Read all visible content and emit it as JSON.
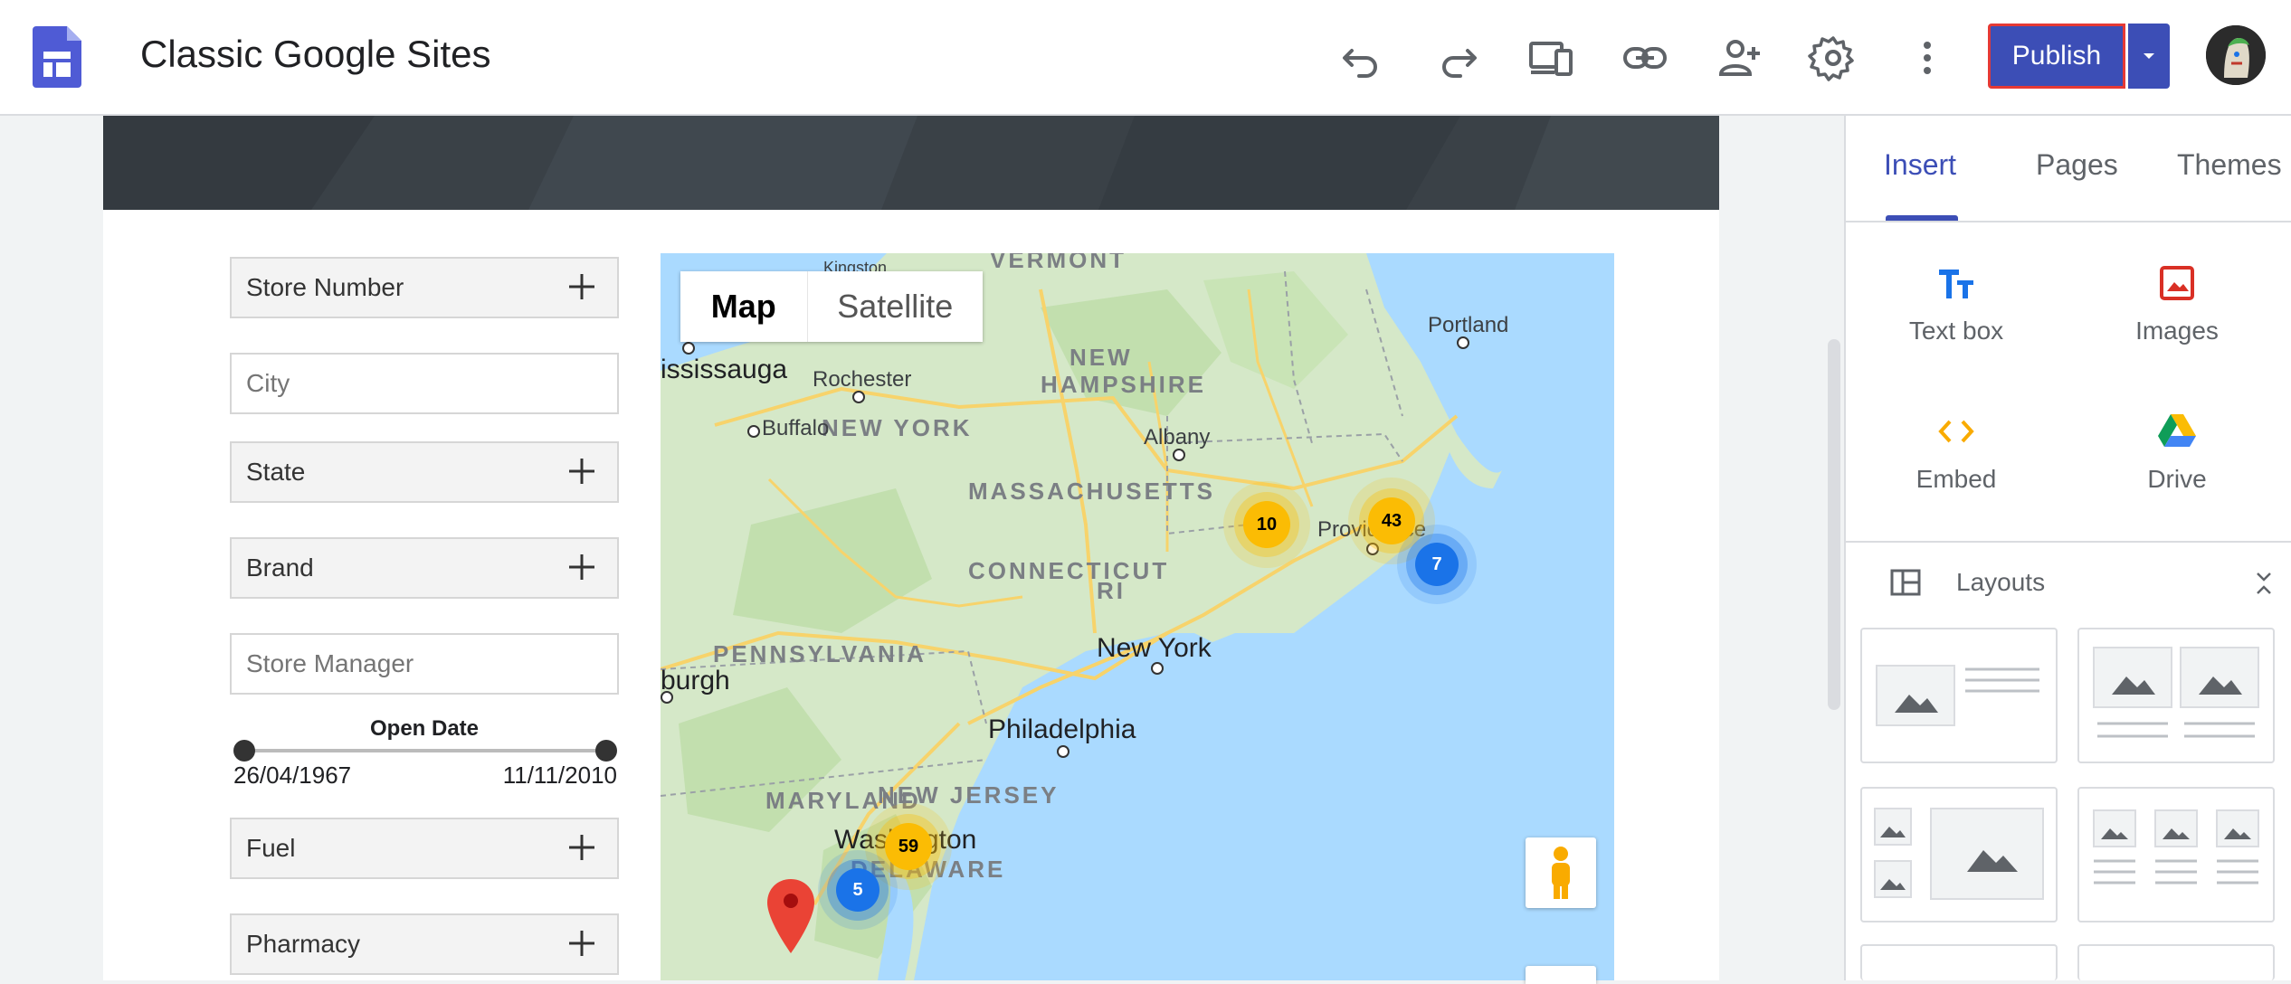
{
  "app": {
    "title": "Classic Google Sites",
    "toolbar": {
      "undo_icon": "undo-icon",
      "redo_icon": "redo-icon",
      "preview_icon": "devices-icon",
      "link_icon": "link-icon",
      "share_icon": "add-person-icon",
      "settings_icon": "gear-icon",
      "more_icon": "more-vert-icon",
      "publish_label": "Publish"
    },
    "accent": "#3c4eb6"
  },
  "filters": {
    "store_number": "Store Number",
    "city_placeholder": "City",
    "state": "State",
    "brand": "Brand",
    "store_manager_placeholder": "Store Manager",
    "open_date": {
      "label": "Open Date",
      "min": "26/04/1967",
      "max": "11/11/2010"
    },
    "fuel": "Fuel",
    "pharmacy": "Pharmacy"
  },
  "map": {
    "type_map": "Map",
    "type_satellite": "Satellite",
    "states": {
      "vermont": "VERMONT",
      "new_hampshire_1": "NEW",
      "new_hampshire_2": "HAMPSHIRE",
      "new_york": "NEW YORK",
      "massachusetts": "MASSACHUSETTS",
      "connecticut": "CONNECTICUT",
      "ri": "RI",
      "pennsylvania": "PENNSYLVANIA",
      "maryland": "MARYLAND",
      "new_jersey": "NEW JERSEY",
      "delaware": "DELAWARE"
    },
    "cities": {
      "kingston": "Kingston",
      "mississauga": "ississauga",
      "rochester": "Rochester",
      "buffalo": "Buffalo",
      "albany": "Albany",
      "portland": "Portland",
      "providence": "Providence",
      "new_york": "New York",
      "pittsburgh": "burgh",
      "philadelphia": "Philadelphia",
      "washington": "Washington"
    },
    "clusters": [
      {
        "count": "10",
        "color": "#fbbc04"
      },
      {
        "count": "43",
        "color": "#fbbc04"
      },
      {
        "count": "7",
        "color": "#1a73e8"
      },
      {
        "count": "59",
        "color": "#fbbc04"
      },
      {
        "count": "5",
        "color": "#1a73e8"
      }
    ]
  },
  "panel": {
    "tabs": [
      "Insert",
      "Pages",
      "Themes"
    ],
    "insert_items": {
      "text_box": "Text box",
      "images": "Images",
      "embed": "Embed",
      "drive": "Drive"
    },
    "layouts_label": "Layouts"
  }
}
